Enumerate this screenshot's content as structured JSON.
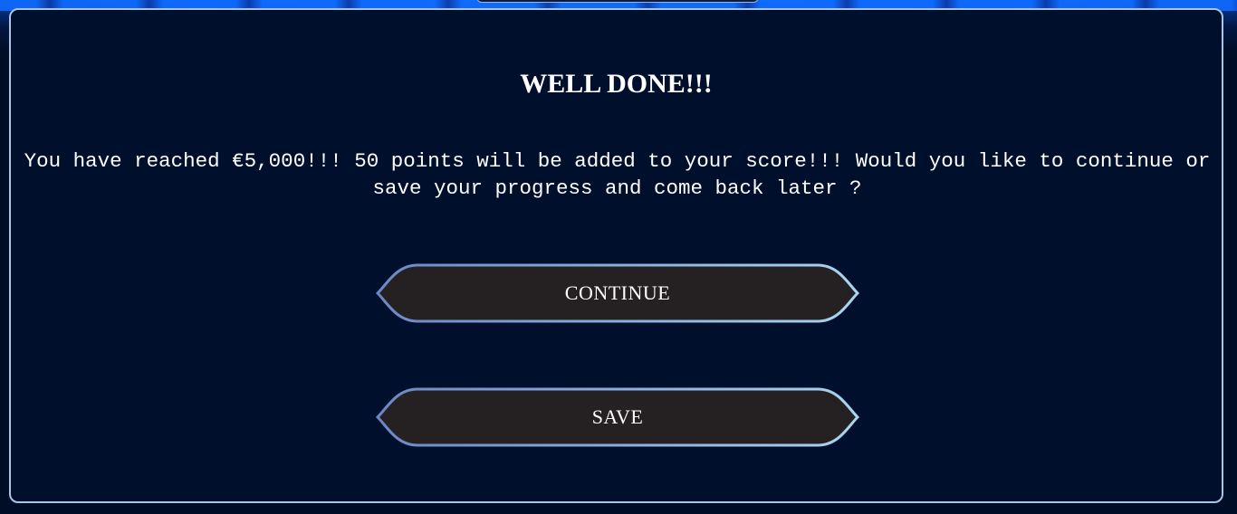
{
  "dialog": {
    "title": "WELL DONE!!!",
    "message": "You have reached €5,000!!! 50 points will be added to your score!!! Would you like to continue or save your progress and come back later ?"
  },
  "buttons": {
    "continue_label": "CONTINUE",
    "save_label": "SAVE"
  },
  "colors": {
    "background": "#000d26",
    "panel": "#000f2b",
    "panel_border": "#a9c6e6",
    "button_fill": "#252122",
    "button_border_left": "#6f8ec9",
    "button_border_right": "#a8d2ee",
    "text": "#ffffff",
    "glow": "#1a8cff"
  }
}
